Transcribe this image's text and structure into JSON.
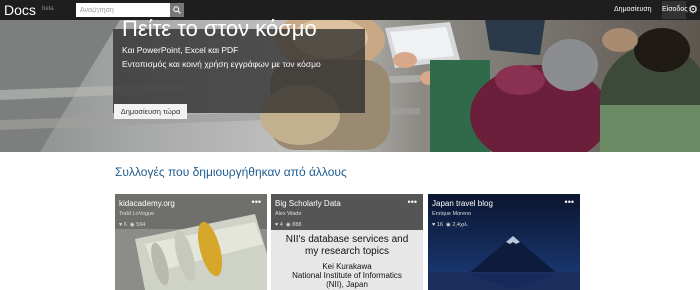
{
  "header": {
    "logo": "Docs",
    "logo_badge": "beta",
    "search_placeholder": "Αναζήτηση",
    "publish_link": "Δημοσίευση",
    "signin_label": "Είσοδος",
    "settings_icon": "gear-icon"
  },
  "hero": {
    "title": "Πείτε το στον κόσμο",
    "subtitle_line1": "Και PowerPoint, Excel και PDF",
    "subtitle_line2": "Εντοπισμός και κοινή χρήση εγγράφων με τον κόσμο",
    "cta_label": "Δημοσίευση τώρα"
  },
  "collections": {
    "title": "Συλλογές που δημιουργήθηκαν από άλλους",
    "cards": [
      {
        "title": "kidacademy.org",
        "author": "Todd LoVogue",
        "likes": "6",
        "views": "594",
        "more": "•••"
      },
      {
        "title": "Big Scholarly Data",
        "author": "Alex Wade",
        "likes": "4",
        "views": "888",
        "more": "•••",
        "slide_line1": "NII's database services and",
        "slide_line2": "my research topics",
        "slide_line3": "Kei Kurakawa",
        "slide_line4": "National Institute of Informatics",
        "slide_line5": "(NII), Japan"
      },
      {
        "title": "Japan travel blog",
        "author": "Enrique Moreno",
        "likes": "16",
        "views": "2,4χιλ.",
        "more": "•••"
      }
    ]
  },
  "colors": {
    "topbar": "#1e1e1e",
    "section_title": "#1f5c8f",
    "hero_panel": "#2d2d2d"
  }
}
